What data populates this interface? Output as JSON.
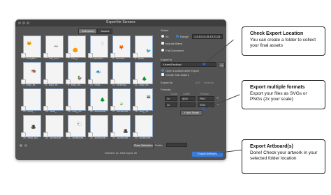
{
  "dialog": {
    "title": "Export for Screens",
    "tabs": [
      {
        "label": "Artboards"
      },
      {
        "label": "Assets"
      }
    ],
    "thumbnails": [
      {
        "label": "1 - complete…",
        "art": "🐱"
      },
      {
        "label": "7 - bold_icon…",
        "art": "〰"
      },
      {
        "label": "2 - Carl_p…",
        "art": "🟠"
      },
      {
        "label": "3 - camerad…",
        "art": "🦷"
      },
      {
        "label": "4 - avocado…",
        "art": "🦊"
      },
      {
        "label": "5 - Illusin…",
        "art": "🐦"
      },
      {
        "label": "1 - body_bit…",
        "art": "🦔"
      },
      {
        "label": "8 - body_bit…",
        "art": ""
      },
      {
        "label": "9 - body_bit…",
        "art": "🦆"
      },
      {
        "label": "10 - head…",
        "art": "🐟"
      },
      {
        "label": "11 - facturing…",
        "art": ""
      },
      {
        "label": "12 - body_bit…",
        "art": "🌲"
      },
      {
        "label": "13 - head_…",
        "art": ""
      },
      {
        "label": "14 - head_…",
        "art": ""
      },
      {
        "label": "15 - body_bit…",
        "art": ""
      },
      {
        "label": "16 - accessorie…",
        "art": "🌲"
      },
      {
        "label": "17 - accessorie…",
        "art": "🍃"
      },
      {
        "label": "18 - body_bit…",
        "art": "🦝"
      },
      {
        "label": "19 - head_acc…",
        "art": "🎩"
      },
      {
        "label": "20 - accessorie…",
        "art": ""
      },
      {
        "label": "21 - accessorie…",
        "art": "🐑"
      },
      {
        "label": "22 - accessorie…",
        "art": ""
      },
      {
        "label": "23 - accessorie…",
        "art": "🎩"
      },
      {
        "label": "24 - accessorie…",
        "art": ""
      }
    ],
    "select": {
      "heading": "Select",
      "all": "All",
      "range": "Range",
      "range_value": "1-4,10,13,15-19,21,24",
      "include_bleed": "Include Bleed",
      "full_document": "Full Document"
    },
    "export_to": {
      "heading": "Export to",
      "path": "/Users/Desktop/",
      "open_location": "Open Location after Export",
      "create_subfolders": "Create Sub-folders"
    },
    "formats": {
      "export_for": "Export for",
      "ios": "iOS",
      "android": "Android",
      "heading": "Formats",
      "col_scale": "Scale",
      "col_suffix": "Suffix",
      "col_format": "Format",
      "rows": [
        {
          "scale": "2x",
          "suffix": "@2x",
          "format": "PNG"
        },
        {
          "scale": "1x",
          "suffix": "",
          "format": "SVG"
        }
      ],
      "add_scale": "+ Add Scale"
    },
    "buttons": {
      "clear_selection": "Clear Selection",
      "prefix_label": "Prefix:",
      "export": "Export Artboard"
    },
    "status": "Selected: 14, Total Export: 28"
  },
  "callouts": [
    {
      "title": "Check Export Location",
      "body": "You can create a folder to collect your final assets"
    },
    {
      "title": "Export multiple formats",
      "body": "Export your files as  SVGs or PNGs (2x your scale)"
    },
    {
      "title": "Export Artboard(s)",
      "body": "Done!  Check your artwork in your selected folder location"
    }
  ],
  "colors": {
    "dialog_bg": "#535353",
    "accent": "#3b7bd9",
    "marker": "#1f66c9"
  }
}
